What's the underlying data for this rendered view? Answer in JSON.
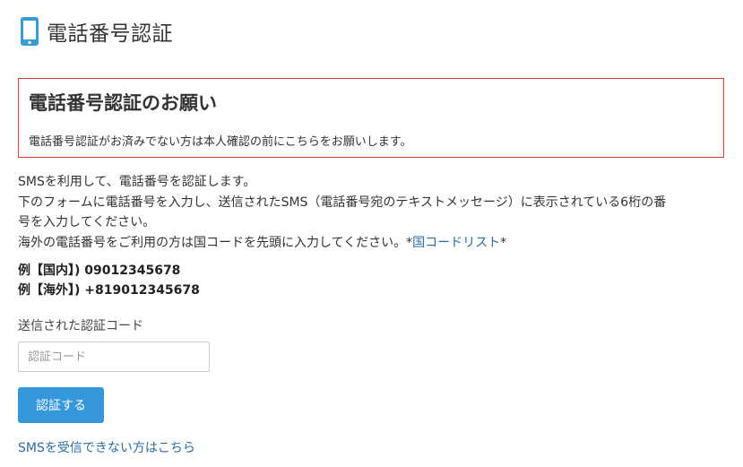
{
  "header": {
    "icon": "smartphone-icon",
    "title": "電話番号認証"
  },
  "alert": {
    "title": "電話番号認証のお願い",
    "message": "電話番号認証がお済みでない方は本人確認の前にこちらをお願いします。",
    "border_color": "#c9433a"
  },
  "description": {
    "line1": "SMSを利用して、電話番号を認証します。",
    "line2": "下のフォームに電話番号を入力し、送信されたSMS（電話番号宛のテキストメッセージ）に表示されている6桁の番",
    "line3": "号を入力してください。",
    "line4_prefix": "海外の電話番号をご利用の方は国コードを先頭に入力してください。*",
    "country_code_link": "国コードリスト",
    "line4_suffix": "*"
  },
  "examples": {
    "domestic": "例【国内】) 09012345678",
    "overseas": "例【海外】) +819012345678"
  },
  "form": {
    "code_label": "送信された認証コード",
    "code_placeholder": "認証コード",
    "code_value": "",
    "submit_label": "認証する",
    "accent_color": "#3498db"
  },
  "footer": {
    "sms_help_link": "SMSを受信できない方はこちら",
    "link_color": "#2e6da4"
  }
}
